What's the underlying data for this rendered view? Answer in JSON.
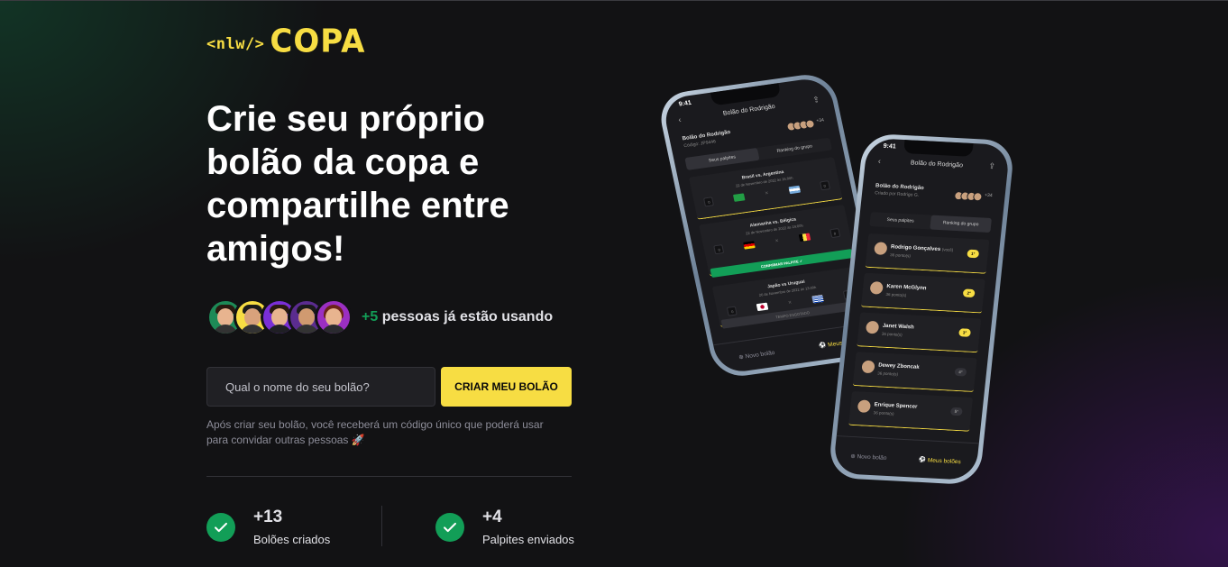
{
  "logo": {
    "tag": "<nlw/>",
    "brand": "COPA"
  },
  "hero": {
    "title": "Crie seu próprio bolão da copa e compartilhe entre amigos!"
  },
  "social_proof": {
    "count": "+5",
    "text": "pessoas já estão usando",
    "avatars": [
      {
        "bg": "#1d8a57",
        "hair": "#2a1a10"
      },
      {
        "bg": "#f7dd43",
        "hair": "#1a1a1a"
      },
      {
        "bg": "#7a2fd6",
        "hair": "#2a1a10"
      },
      {
        "bg": "#5b2c8f",
        "hair": "#1a1a1a"
      },
      {
        "bg": "#9b2fc2",
        "hair": "#6b2418"
      }
    ]
  },
  "form": {
    "placeholder": "Qual o nome do seu bolão?",
    "submit_label": "CRIAR MEU BOLÃO"
  },
  "hint": "Após criar seu bolão, você receberá um código único que poderá usar para convidar outras pessoas 🚀",
  "stats": [
    {
      "value": "+13",
      "label": "Bolões criados"
    },
    {
      "value": "+4",
      "label": "Palpites enviados"
    }
  ],
  "phone_back": {
    "time": "9:41",
    "title": "Bolão do Rodrigão",
    "pool_name": "Bolão do Rodrigão",
    "code": "Código: JP9446",
    "more": "+34",
    "tabs": [
      "Seus palpites",
      "Ranking do grupo"
    ],
    "games": [
      {
        "title": "Brasil vs. Argentina",
        "date": "22 de Novembro de 2022 às 16:00h"
      },
      {
        "title": "Alemanha vs. Bélgica",
        "date": "22 de Novembro de 2022 às 19:00h"
      },
      {
        "title": "Japão vs Uruguai",
        "date": "26 de Novembro de 2022 às 13:00h"
      }
    ],
    "confirm": "CONFIRMAR PALPITE ✓",
    "expired": "TEMPO ESGOTADO",
    "footer": [
      "Novo bolão",
      "Meus bolões"
    ]
  },
  "phone_front": {
    "time": "9:41",
    "title": "Bolão do Rodrigão",
    "pool_name": "Bolão do Rodrigão",
    "creator": "Criado por Rodrigo G.",
    "more": "+34",
    "tabs": [
      "Seus palpites",
      "Ranking do grupo"
    ],
    "ranking": [
      {
        "name": "Rodrigo Gonçalves",
        "suffix": "(você)",
        "points": "36 ponto(s)",
        "rank": "1°"
      },
      {
        "name": "Karen McGlynn",
        "points": "36 ponto(s)",
        "rank": "2°"
      },
      {
        "name": "Janet Walsh",
        "points": "36 ponto(s)",
        "rank": "3°"
      },
      {
        "name": "Dewey Zboncak",
        "points": "36 ponto(s)",
        "rank": "4°"
      },
      {
        "name": "Enrique Spencer",
        "points": "36 ponto(s)",
        "rank": "5°"
      }
    ],
    "footer": [
      "Novo bolão",
      "Meus bolões"
    ]
  },
  "colors": {
    "accent": "#f7dd43",
    "success": "#129e57",
    "background": "#121214"
  }
}
